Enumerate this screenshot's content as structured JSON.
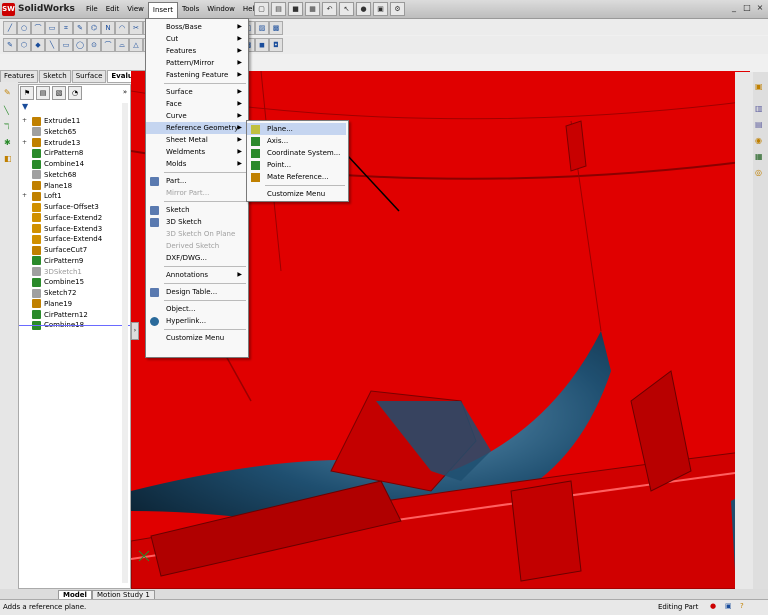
{
  "app": {
    "name": "SolidWorks",
    "logo_text": "SW"
  },
  "menubar": [
    "File",
    "Edit",
    "View",
    "Insert",
    "Tools",
    "Window",
    "Help"
  ],
  "window_controls": [
    "_",
    "□",
    "×"
  ],
  "command_tabs": [
    "Features",
    "Sketch",
    "Surface",
    "Evaluate"
  ],
  "feature_tree": [
    {
      "label": "Extrude11",
      "expand": "+",
      "icon": "extrude-icon",
      "grey": false
    },
    {
      "label": "Sketch65",
      "expand": "",
      "icon": "sketch-icon",
      "grey": false
    },
    {
      "label": "Extrude13",
      "expand": "+",
      "icon": "extrude-icon",
      "grey": false
    },
    {
      "label": "CirPattern8",
      "expand": "",
      "icon": "pattern-icon",
      "grey": false
    },
    {
      "label": "Combine14",
      "expand": "",
      "icon": "combine-icon",
      "grey": false
    },
    {
      "label": "Sketch68",
      "expand": "",
      "icon": "sketch-icon",
      "grey": false
    },
    {
      "label": "Plane18",
      "expand": "",
      "icon": "plane-icon",
      "grey": false
    },
    {
      "label": "Loft1",
      "expand": "+",
      "icon": "loft-icon",
      "grey": false
    },
    {
      "label": "Surface-Offset3",
      "expand": "",
      "icon": "surface-icon",
      "grey": false
    },
    {
      "label": "Surface-Extend2",
      "expand": "",
      "icon": "surface-icon",
      "grey": false
    },
    {
      "label": "Surface-Extend3",
      "expand": "",
      "icon": "surface-icon",
      "grey": false
    },
    {
      "label": "Surface-Extend4",
      "expand": "",
      "icon": "surface-icon",
      "grey": false
    },
    {
      "label": "SurfaceCut7",
      "expand": "",
      "icon": "cut-icon",
      "grey": false
    },
    {
      "label": "CirPattern9",
      "expand": "",
      "icon": "pattern-icon",
      "grey": false
    },
    {
      "label": "3DSketch1",
      "expand": "",
      "icon": "sketch-icon",
      "grey": true
    },
    {
      "label": "Combine15",
      "expand": "",
      "icon": "combine-icon",
      "grey": false
    },
    {
      "label": "Sketch72",
      "expand": "",
      "icon": "sketch-icon",
      "grey": false
    },
    {
      "label": "Plane19",
      "expand": "",
      "icon": "plane-icon",
      "grey": false
    },
    {
      "label": "CirPattern12",
      "expand": "",
      "icon": "pattern-icon",
      "grey": false
    },
    {
      "label": "Combine18",
      "expand": "",
      "icon": "combine-icon",
      "grey": false
    }
  ],
  "insert_menu": [
    {
      "label": "Boss/Base",
      "submenu": true,
      "grey": false,
      "icon": ""
    },
    {
      "label": "Cut",
      "submenu": true,
      "grey": false,
      "icon": ""
    },
    {
      "label": "Features",
      "submenu": true,
      "grey": false,
      "icon": ""
    },
    {
      "label": "Pattern/Mirror",
      "submenu": true,
      "grey": false,
      "icon": ""
    },
    {
      "label": "Fastening Feature",
      "submenu": true,
      "grey": false,
      "icon": ""
    },
    {
      "sep": true
    },
    {
      "label": "Surface",
      "submenu": true,
      "grey": false,
      "icon": ""
    },
    {
      "label": "Face",
      "submenu": true,
      "grey": false,
      "icon": ""
    },
    {
      "label": "Curve",
      "submenu": true,
      "grey": false,
      "icon": ""
    },
    {
      "label": "Reference Geometry",
      "submenu": true,
      "grey": false,
      "icon": "",
      "highlight": true
    },
    {
      "label": "Sheet Metal",
      "submenu": true,
      "grey": false,
      "icon": ""
    },
    {
      "label": "Weldments",
      "submenu": true,
      "grey": false,
      "icon": ""
    },
    {
      "label": "Molds",
      "submenu": true,
      "grey": false,
      "icon": ""
    },
    {
      "sep": true
    },
    {
      "label": "Part...",
      "submenu": false,
      "grey": false,
      "icon": "part-icon"
    },
    {
      "label": "Mirror Part...",
      "submenu": false,
      "grey": true,
      "icon": ""
    },
    {
      "sep": true
    },
    {
      "label": "Sketch",
      "submenu": false,
      "grey": false,
      "icon": "sketch-icon"
    },
    {
      "label": "3D Sketch",
      "submenu": false,
      "grey": false,
      "icon": "3dsketch-icon"
    },
    {
      "label": "3D Sketch On Plane",
      "submenu": false,
      "grey": true,
      "icon": ""
    },
    {
      "label": "Derived Sketch",
      "submenu": false,
      "grey": true,
      "icon": ""
    },
    {
      "label": "DXF/DWG...",
      "submenu": false,
      "grey": false,
      "icon": ""
    },
    {
      "sep": true
    },
    {
      "label": "Annotations",
      "submenu": true,
      "grey": false,
      "icon": ""
    },
    {
      "sep": true
    },
    {
      "label": "Design Table...",
      "submenu": false,
      "grey": false,
      "icon": "table-icon"
    },
    {
      "sep": true
    },
    {
      "label": "Object...",
      "submenu": false,
      "grey": false,
      "icon": ""
    },
    {
      "label": "Hyperlink...",
      "submenu": false,
      "grey": false,
      "icon": "globe-icon"
    },
    {
      "sep": true
    },
    {
      "label": "Customize Menu",
      "submenu": false,
      "grey": false,
      "icon": ""
    }
  ],
  "ref_geom_menu": [
    {
      "label": "Plane...",
      "icon": "plane-icon",
      "highlight": true
    },
    {
      "label": "Axis...",
      "icon": "axis-icon"
    },
    {
      "label": "Coordinate System...",
      "icon": "coordinate-icon"
    },
    {
      "label": "Point...",
      "icon": "point-icon"
    },
    {
      "label": "Mate Reference...",
      "icon": "mate-icon"
    },
    {
      "sep": true
    },
    {
      "label": "Customize Menu",
      "icon": ""
    }
  ],
  "bottom_tabs": [
    "Model",
    "Motion Study 1"
  ],
  "status": {
    "left": "Adds a reference plane.",
    "right": "Editing Part"
  },
  "colors": {
    "viewport_red": "#e00000",
    "cavity_blue": "#1f4f70",
    "menu_highlight": "#c5d5f0"
  }
}
